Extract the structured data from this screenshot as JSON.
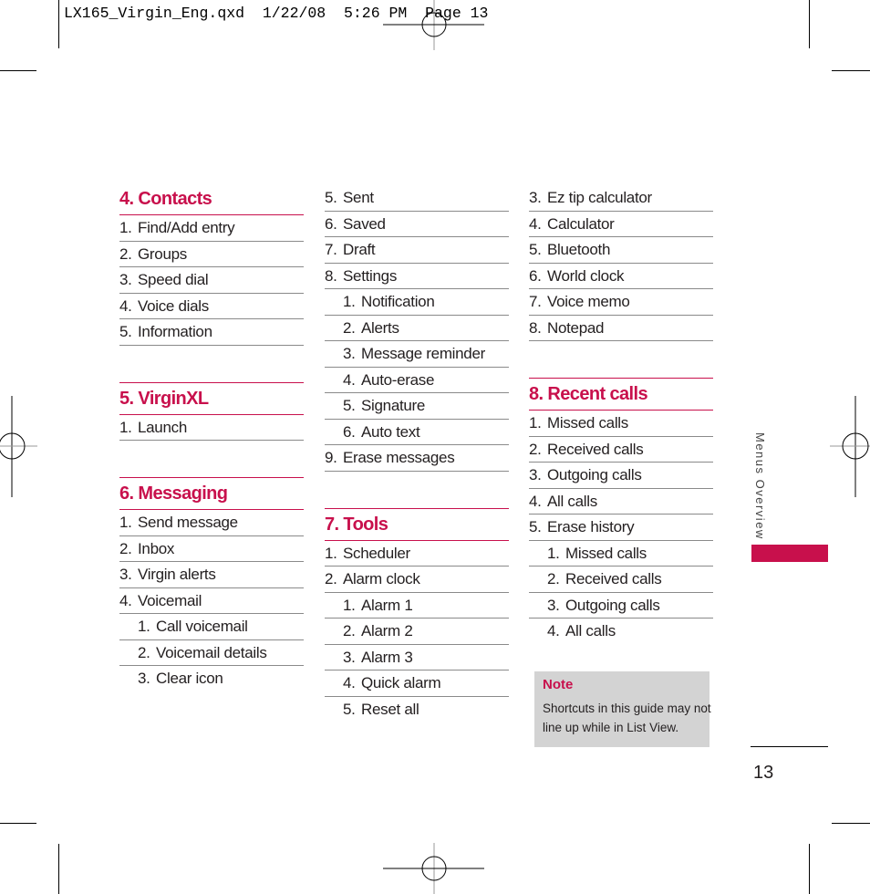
{
  "slug": {
    "filename": "LX165_Virgin_Eng.qxd",
    "date": "1/22/08",
    "time": "5:26 PM",
    "page_label": "Page 13"
  },
  "columns": [
    {
      "sections": [
        {
          "title": "4. Contacts",
          "items": [
            {
              "num": "1.",
              "label": "Find/Add entry",
              "level": 0
            },
            {
              "num": "2.",
              "label": "Groups",
              "level": 0
            },
            {
              "num": "3.",
              "label": "Speed dial",
              "level": 0
            },
            {
              "num": "4.",
              "label": "Voice dials",
              "level": 0
            },
            {
              "num": "5.",
              "label": "Information",
              "level": 0
            }
          ]
        },
        {
          "title": "5. VirginXL",
          "items": [
            {
              "num": "1.",
              "label": "Launch",
              "level": 0
            }
          ]
        },
        {
          "title": "6. Messaging",
          "items": [
            {
              "num": "1.",
              "label": "Send message",
              "level": 0
            },
            {
              "num": "2.",
              "label": "Inbox",
              "level": 0
            },
            {
              "num": "3.",
              "label": "Virgin alerts",
              "level": 0
            },
            {
              "num": "4.",
              "label": "Voicemail",
              "level": 0
            },
            {
              "num": "1.",
              "label": "Call voicemail",
              "level": 1
            },
            {
              "num": "2.",
              "label": "Voicemail details",
              "level": 1
            },
            {
              "num": "3.",
              "label": "Clear icon",
              "level": 1
            }
          ]
        }
      ]
    },
    {
      "sections": [
        {
          "title": "",
          "items": [
            {
              "num": "5.",
              "label": "Sent",
              "level": 0
            },
            {
              "num": "6.",
              "label": "Saved",
              "level": 0
            },
            {
              "num": "7.",
              "label": "Draft",
              "level": 0
            },
            {
              "num": "8.",
              "label": "Settings",
              "level": 0
            },
            {
              "num": "1.",
              "label": "Notification",
              "level": 1
            },
            {
              "num": "2.",
              "label": "Alerts",
              "level": 1
            },
            {
              "num": "3.",
              "label": "Message reminder",
              "level": 1
            },
            {
              "num": "4.",
              "label": "Auto-erase",
              "level": 1
            },
            {
              "num": "5.",
              "label": "Signature",
              "level": 1
            },
            {
              "num": "6.",
              "label": "Auto text",
              "level": 1
            },
            {
              "num": "9.",
              "label": "Erase messages",
              "level": 0
            }
          ]
        },
        {
          "title": "7. Tools",
          "items": [
            {
              "num": "1.",
              "label": "Scheduler",
              "level": 0
            },
            {
              "num": "2.",
              "label": "Alarm clock",
              "level": 0
            },
            {
              "num": "1.",
              "label": "Alarm 1",
              "level": 1
            },
            {
              "num": "2.",
              "label": "Alarm 2",
              "level": 1
            },
            {
              "num": "3.",
              "label": "Alarm 3",
              "level": 1
            },
            {
              "num": "4.",
              "label": "Quick alarm",
              "level": 1
            },
            {
              "num": "5.",
              "label": "Reset all",
              "level": 1
            }
          ]
        }
      ]
    },
    {
      "sections": [
        {
          "title": "",
          "items": [
            {
              "num": "3.",
              "label": "Ez tip calculator",
              "level": 0
            },
            {
              "num": "4.",
              "label": "Calculator",
              "level": 0
            },
            {
              "num": "5.",
              "label": "Bluetooth",
              "level": 0
            },
            {
              "num": "6.",
              "label": "World clock",
              "level": 0
            },
            {
              "num": "7.",
              "label": "Voice memo",
              "level": 0
            },
            {
              "num": "8.",
              "label": "Notepad",
              "level": 0
            }
          ]
        },
        {
          "title": "8. Recent calls",
          "items": [
            {
              "num": "1.",
              "label": "Missed calls",
              "level": 0
            },
            {
              "num": "2.",
              "label": "Received calls",
              "level": 0
            },
            {
              "num": "3.",
              "label": "Outgoing calls",
              "level": 0
            },
            {
              "num": "4.",
              "label": "All calls",
              "level": 0
            },
            {
              "num": "5.",
              "label": "Erase history",
              "level": 0
            },
            {
              "num": "1.",
              "label": "Missed calls",
              "level": 1
            },
            {
              "num": "2.",
              "label": "Received calls",
              "level": 1
            },
            {
              "num": "3.",
              "label": "Outgoing calls",
              "level": 1
            },
            {
              "num": "4.",
              "label": "All calls",
              "level": 1
            }
          ]
        }
      ]
    }
  ],
  "note": {
    "title": "Note",
    "text": "Shortcuts in this guide may not line up while in List View."
  },
  "sidebar": {
    "section_label": "Menus Overview",
    "accent_color": "#c8104c"
  },
  "page_number": "13"
}
